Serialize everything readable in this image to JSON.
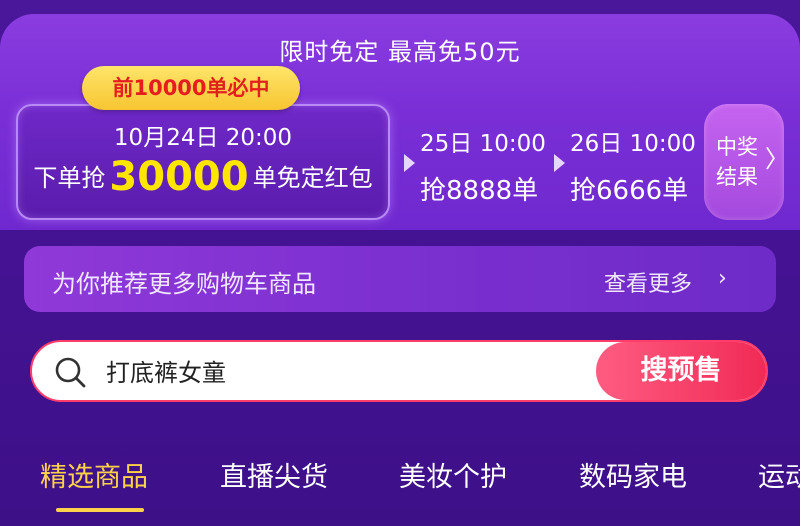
{
  "promo": {
    "title": "限时免定 最高免50元",
    "first_badge": "前10000单必中",
    "main": {
      "time": "10月24日 20:00",
      "prefix": "下单抢",
      "count": "30000",
      "suffix": "单免定红包"
    },
    "stages": [
      {
        "time": "25日 10:00",
        "count": "抢8888单"
      },
      {
        "time": "26日 10:00",
        "count": "抢6666单"
      }
    ],
    "winner_button": "中奖结果"
  },
  "recommend": {
    "text": "为你推荐更多购物车商品",
    "more": "查看更多"
  },
  "search": {
    "value": "打底裤女童",
    "button": "搜预售"
  },
  "tabs": [
    "精选商品",
    "直播尖货",
    "美妆个护",
    "数码家电",
    "运动"
  ],
  "active_tab": 0,
  "colors": {
    "background": "#44128f",
    "card": "#7a2fd6",
    "highlight": "#ffe600",
    "badge": "#f7c531",
    "search_accent": "#f02a55",
    "active_tab": "#ffd24a"
  },
  "icons": {
    "search": "search-icon",
    "arrow": "triangle-right-icon",
    "chevron": "chevron-right-icon"
  }
}
